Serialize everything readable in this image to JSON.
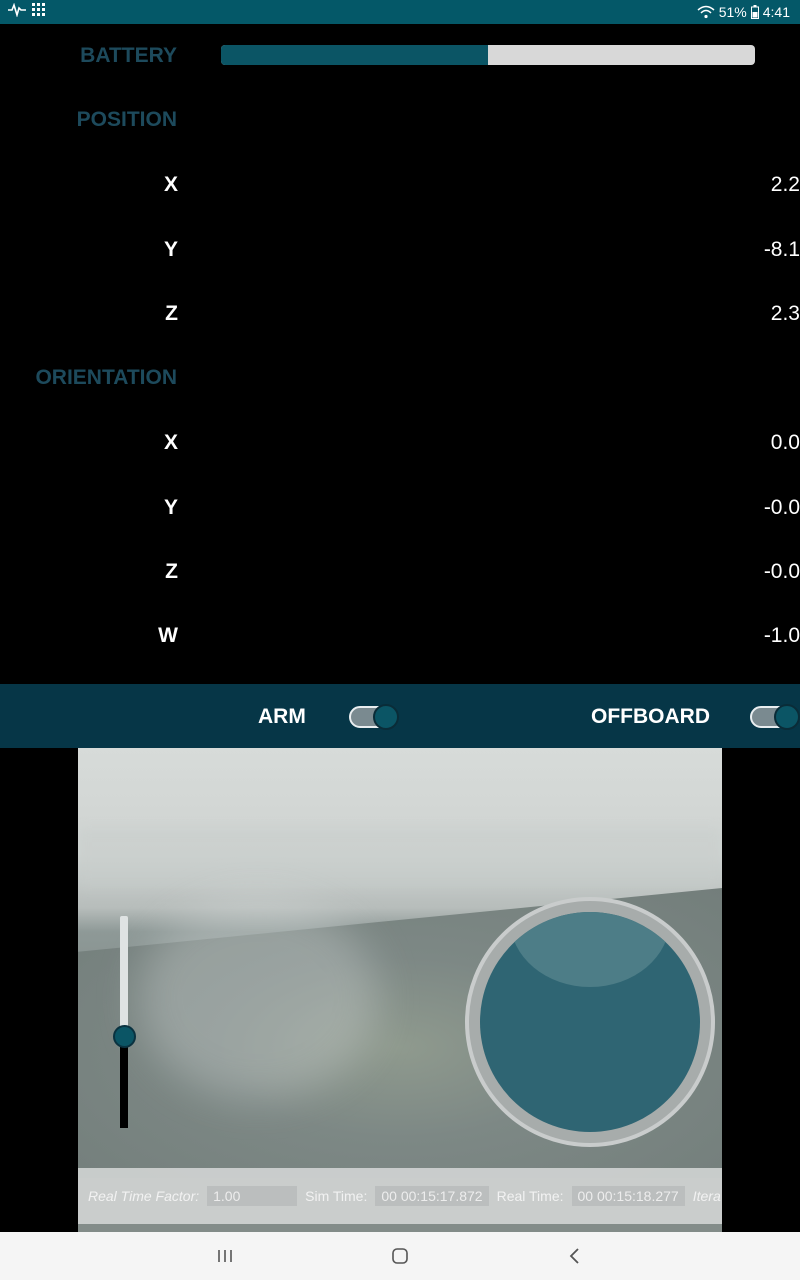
{
  "status_bar": {
    "left_icons": [
      "pulse-icon",
      "grid-icon"
    ],
    "wifi_icon": "wifi-icon",
    "battery_percent": "51%",
    "battery_icon": "battery-icon",
    "time": "4:41"
  },
  "telemetry": {
    "battery_label": "BATTERY",
    "battery_level": 0.5,
    "position_title": "POSITION",
    "position": [
      {
        "label": "X",
        "value": "2.2"
      },
      {
        "label": "Y",
        "value": "-8.1"
      },
      {
        "label": "Z",
        "value": "2.3"
      }
    ],
    "orientation_title": "ORIENTATION",
    "orientation": [
      {
        "label": "X",
        "value": "0.0"
      },
      {
        "label": "Y",
        "value": "-0.0"
      },
      {
        "label": "Z",
        "value": "-0.0"
      },
      {
        "label": "W",
        "value": "-1.0"
      }
    ]
  },
  "controls": {
    "arm_label": "ARM",
    "arm_on": true,
    "offboard_label": "OFFBOARD",
    "offboard_on": true
  },
  "camera": {
    "real_time_factor_label": "Real Time Factor:",
    "real_time_factor_value": "1.00",
    "sim_time_label": "Sim Time:",
    "sim_time_value": "00 00:15:17.872",
    "real_time_label": "Real Time:",
    "real_time_value": "00 00:15:18.277",
    "iterations_label": "Itera",
    "throttle_level": 0.43
  },
  "nav_bar": {
    "recents_icon": "recents-icon",
    "home_icon": "home-icon",
    "back_icon": "back-icon"
  },
  "colors": {
    "status_bar": "#045868",
    "accent": "#0b5565",
    "control_bar": "#063647",
    "section_title": "#1d4a5c"
  }
}
